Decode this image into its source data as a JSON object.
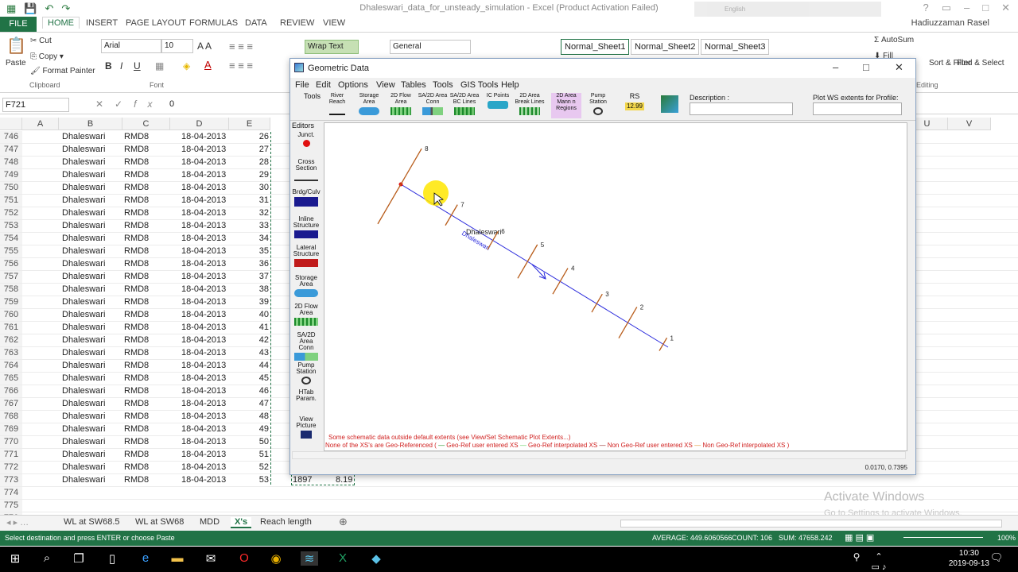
{
  "excel": {
    "title": "Dhaleswari_data_for_unsteady_simulation - Excel (Product Activation Failed)",
    "user": "Hadiuzzaman Rasel",
    "lang": "English",
    "tabs": [
      "FILE",
      "HOME",
      "INSERT",
      "PAGE LAYOUT",
      "FORMULAS",
      "DATA",
      "REVIEW",
      "VIEW"
    ],
    "clipboard": {
      "paste": "Paste",
      "cut": "Cut",
      "copy": "Copy",
      "format_painter": "Format Painter",
      "group": "Clipboard"
    },
    "font": {
      "name": "Arial",
      "size": "10",
      "group": "Font"
    },
    "alignment": {
      "wrap_text": "Wrap Text"
    },
    "number": {
      "format": "General"
    },
    "styles": [
      "Normal_Sheet1",
      "Normal_Sheet2",
      "Normal_Sheet3"
    ],
    "editing": {
      "autosum": "AutoSum",
      "fill": "Fill",
      "sort": "Sort & Filter",
      "find": "Find & Select",
      "group": "Editing"
    },
    "name_box": "F721",
    "formula_value": "0",
    "columns": [
      "A",
      "B",
      "C",
      "D",
      "E",
      "U",
      "V"
    ],
    "rows": [
      {
        "n": "746",
        "b": "Dhaleswari",
        "c": "RMD8",
        "d": "18-04-2013",
        "e": "26"
      },
      {
        "n": "747",
        "b": "Dhaleswari",
        "c": "RMD8",
        "d": "18-04-2013",
        "e": "27"
      },
      {
        "n": "748",
        "b": "Dhaleswari",
        "c": "RMD8",
        "d": "18-04-2013",
        "e": "28"
      },
      {
        "n": "749",
        "b": "Dhaleswari",
        "c": "RMD8",
        "d": "18-04-2013",
        "e": "29"
      },
      {
        "n": "750",
        "b": "Dhaleswari",
        "c": "RMD8",
        "d": "18-04-2013",
        "e": "30"
      },
      {
        "n": "751",
        "b": "Dhaleswari",
        "c": "RMD8",
        "d": "18-04-2013",
        "e": "31"
      },
      {
        "n": "752",
        "b": "Dhaleswari",
        "c": "RMD8",
        "d": "18-04-2013",
        "e": "32"
      },
      {
        "n": "753",
        "b": "Dhaleswari",
        "c": "RMD8",
        "d": "18-04-2013",
        "e": "33"
      },
      {
        "n": "754",
        "b": "Dhaleswari",
        "c": "RMD8",
        "d": "18-04-2013",
        "e": "34"
      },
      {
        "n": "755",
        "b": "Dhaleswari",
        "c": "RMD8",
        "d": "18-04-2013",
        "e": "35"
      },
      {
        "n": "756",
        "b": "Dhaleswari",
        "c": "RMD8",
        "d": "18-04-2013",
        "e": "36"
      },
      {
        "n": "757",
        "b": "Dhaleswari",
        "c": "RMD8",
        "d": "18-04-2013",
        "e": "37"
      },
      {
        "n": "758",
        "b": "Dhaleswari",
        "c": "RMD8",
        "d": "18-04-2013",
        "e": "38"
      },
      {
        "n": "759",
        "b": "Dhaleswari",
        "c": "RMD8",
        "d": "18-04-2013",
        "e": "39"
      },
      {
        "n": "760",
        "b": "Dhaleswari",
        "c": "RMD8",
        "d": "18-04-2013",
        "e": "40"
      },
      {
        "n": "761",
        "b": "Dhaleswari",
        "c": "RMD8",
        "d": "18-04-2013",
        "e": "41"
      },
      {
        "n": "762",
        "b": "Dhaleswari",
        "c": "RMD8",
        "d": "18-04-2013",
        "e": "42"
      },
      {
        "n": "763",
        "b": "Dhaleswari",
        "c": "RMD8",
        "d": "18-04-2013",
        "e": "43"
      },
      {
        "n": "764",
        "b": "Dhaleswari",
        "c": "RMD8",
        "d": "18-04-2013",
        "e": "44"
      },
      {
        "n": "765",
        "b": "Dhaleswari",
        "c": "RMD8",
        "d": "18-04-2013",
        "e": "45"
      },
      {
        "n": "766",
        "b": "Dhaleswari",
        "c": "RMD8",
        "d": "18-04-2013",
        "e": "46"
      },
      {
        "n": "767",
        "b": "Dhaleswari",
        "c": "RMD8",
        "d": "18-04-2013",
        "e": "47"
      },
      {
        "n": "768",
        "b": "Dhaleswari",
        "c": "RMD8",
        "d": "18-04-2013",
        "e": "48"
      },
      {
        "n": "769",
        "b": "Dhaleswari",
        "c": "RMD8",
        "d": "18-04-2013",
        "e": "49"
      },
      {
        "n": "770",
        "b": "Dhaleswari",
        "c": "RMD8",
        "d": "18-04-2013",
        "e": "50"
      },
      {
        "n": "771",
        "b": "Dhaleswari",
        "c": "RMD8",
        "d": "18-04-2013",
        "e": "51"
      },
      {
        "n": "772",
        "b": "Dhaleswari",
        "c": "RMD8",
        "d": "18-04-2013",
        "e": "52"
      },
      {
        "n": "773",
        "b": "Dhaleswari",
        "c": "RMD8",
        "d": "18-04-2013",
        "e": "53"
      },
      {
        "n": "774",
        "b": "",
        "c": "",
        "d": "",
        "e": ""
      },
      {
        "n": "775",
        "b": "",
        "c": "",
        "d": "",
        "e": ""
      },
      {
        "n": "776",
        "b": "",
        "c": "",
        "d": "",
        "e": ""
      }
    ],
    "selection_values": [
      "1897",
      "8.19"
    ],
    "sheet_tabs": [
      "WL at SW68.5",
      "WL at SW68",
      "MDD",
      "X's",
      "Reach length"
    ],
    "active_sheet": "X's",
    "status": {
      "message": "Select destination and press ENTER or choose Paste",
      "average": "AVERAGE: 449.6060566",
      "count": "COUNT: 106",
      "sum": "SUM: 47658.242",
      "zoom": "100%"
    },
    "watermark": {
      "title": "Activate Windows",
      "subtitle": "Go to Settings to activate Windows."
    }
  },
  "geometric_data": {
    "title": "Geometric Data",
    "menu": [
      "File",
      "Edit",
      "Options",
      "View",
      "Tables",
      "Tools",
      "GIS Tools",
      "Help"
    ],
    "toolbar": [
      {
        "label": "Tools",
        "icon": "pointer-icon"
      },
      {
        "label": "River Reach",
        "icon": "river-reach-icon"
      },
      {
        "label": "Storage Area",
        "icon": "storage-area-icon"
      },
      {
        "label": "2D Flow Area",
        "icon": "flow-area-icon"
      },
      {
        "label": "SA/2D Area Conn",
        "icon": "connection-icon"
      },
      {
        "label": "SA/2D Area BC Lines",
        "icon": "bc-lines-icon"
      },
      {
        "label": "IC Points",
        "icon": "ic-points-icon"
      },
      {
        "label": "2D Area Break Lines",
        "icon": "break-lines-icon"
      },
      {
        "label": "2D Area Mann n Regions",
        "icon": "manning-icon"
      },
      {
        "label": "Pump Station",
        "icon": "pump-station-icon"
      },
      {
        "label": "RS",
        "sub": "12.99",
        "icon": "river-station-icon"
      }
    ],
    "description_label": "Description :",
    "plot_ws_label": "Plot WS extents for Profile:",
    "editors_label": "Editors",
    "editors": [
      "Junct.",
      "Cross Section",
      "Brdg/Culv",
      "Inline Structure",
      "Lateral Structure",
      "Storage Area",
      "2D Flow Area",
      "SA/2D Area Conn",
      "Pump Station",
      "HTab Param.",
      "View Picture"
    ],
    "schematic": {
      "river_name": "Dhaleswari",
      "reach_name": "Dhaleswari",
      "cross_sections": [
        {
          "label": "8"
        },
        {
          "label": "7"
        },
        {
          "label": "6"
        },
        {
          "label": "5"
        },
        {
          "label": "4"
        },
        {
          "label": "3"
        },
        {
          "label": "2"
        },
        {
          "label": "1"
        }
      ],
      "colors": {
        "reach": "#2a2adc",
        "xs": "#b85c1a",
        "junction": "#e01010"
      }
    },
    "warning": "Some schematic data outside default extents (see View/Set Schematic Plot Extents...)",
    "legend": {
      "prefix": "None of the XS's are Geo-Referenced (",
      "items": [
        {
          "label": "Geo-Ref user entered XS",
          "color": "#1a8f1a"
        },
        {
          "label": "Geo-Ref interpolated XS",
          "color": "#5fd05f"
        },
        {
          "label": "Non Geo-Ref user entered XS",
          "color": "#8b1a1a"
        },
        {
          "label": "Non Geo-Ref interpolated XS",
          "color": "#e0902a"
        }
      ],
      "suffix": ")"
    },
    "coords": "0.0170, 0.7395"
  },
  "taskbar": {
    "time": "10:30",
    "date": "2019-09-13"
  }
}
